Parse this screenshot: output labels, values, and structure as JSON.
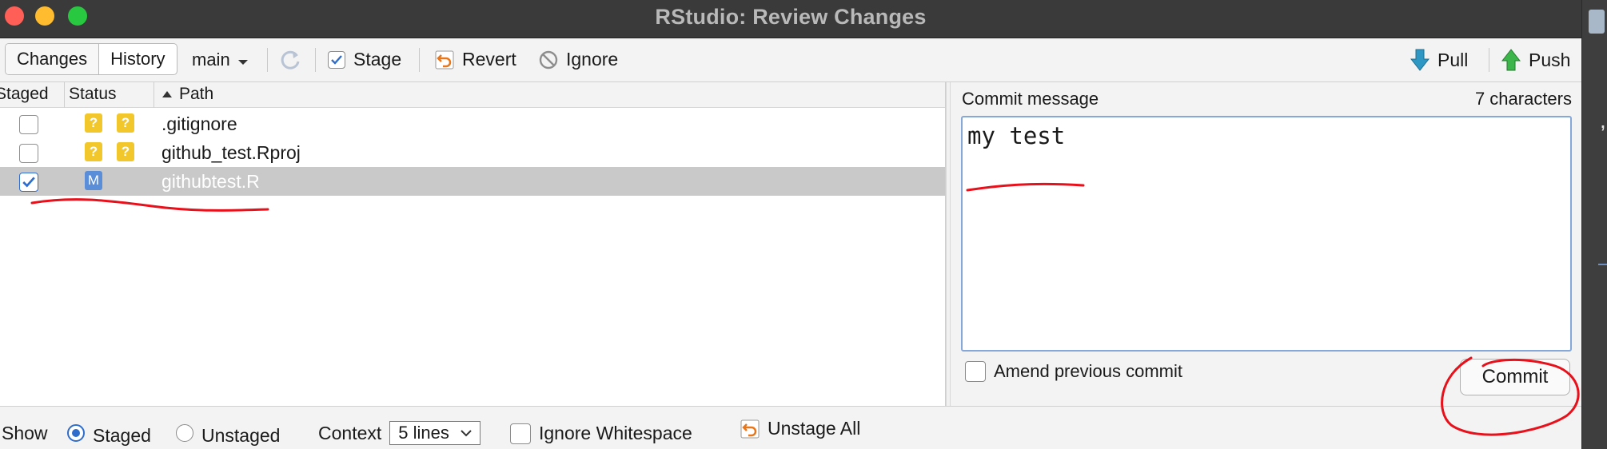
{
  "window": {
    "title": "RStudio: Review Changes"
  },
  "toolbar": {
    "tabs": [
      {
        "label": "Changes"
      },
      {
        "label": "History"
      }
    ],
    "branch": "main",
    "stage": "Stage",
    "revert": "Revert",
    "ignore": "Ignore",
    "pull": "Pull",
    "push": "Push"
  },
  "files": {
    "headers": {
      "staged": "Staged",
      "status": "Status",
      "path": "Path"
    },
    "rows": [
      {
        "staged": false,
        "status": [
          "?",
          "?"
        ],
        "path": ".gitignore"
      },
      {
        "staged": false,
        "status": [
          "?",
          "?"
        ],
        "path": "github_test.Rproj"
      },
      {
        "staged": true,
        "status": [
          "M"
        ],
        "path": "githubtest.R",
        "selected": true
      }
    ]
  },
  "commit": {
    "label": "Commit message",
    "count": "7 characters",
    "message": "my test",
    "amend_label": "Amend previous commit",
    "button": "Commit"
  },
  "bottom": {
    "show": "Show",
    "staged": "Staged",
    "unstaged": "Unstaged",
    "context": "Context",
    "context_value": "5 lines",
    "ignore_ws": "Ignore Whitespace",
    "unstage_all": "Unstage All"
  },
  "colors": {
    "accent": "#2f6dcc",
    "unknown_badge": "#f2c72b",
    "modified_badge": "#5a8ed8",
    "annotation": "#e8101a"
  }
}
